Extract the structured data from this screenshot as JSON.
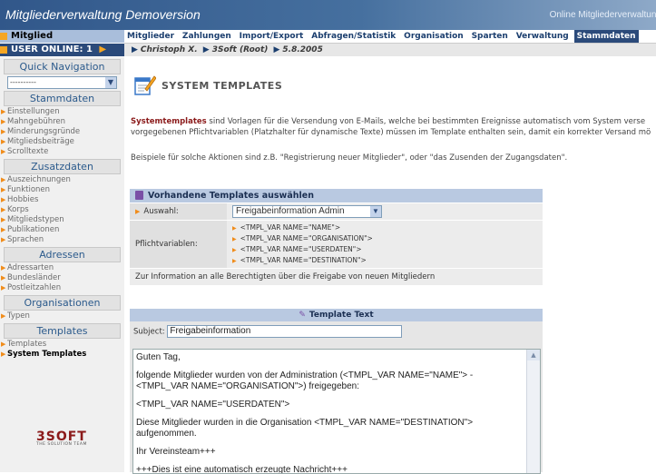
{
  "app": {
    "title": "Mitgliederverwaltung Demoversion",
    "top_right": "Online Mitgliederverwaltung"
  },
  "left": {
    "head_mitglied": "Mitglied",
    "user_online": "USER ONLINE: 1",
    "quick_nav": "Quick Navigation",
    "quick_select": "----------",
    "stammdaten_title": "Stammdaten",
    "stammdaten_items": [
      "Einstellungen",
      "Mahngebühren",
      "Minderungsgründe",
      "Mitgliedsbeiträge",
      "Scrolltexte"
    ],
    "zusatzdaten_title": "Zusatzdaten",
    "zusatzdaten_items": [
      "Auszeichnungen",
      "Funktionen",
      "Hobbies",
      "Korps",
      "Mitgliedstypen",
      "Publikationen",
      "Sprachen"
    ],
    "adressen_title": "Adressen",
    "adressen_items": [
      "Adressarten",
      "Bundesländer",
      "Postleitzahlen"
    ],
    "organisationen_title": "Organisationen",
    "organisationen_items": [
      "Typen"
    ],
    "templates_title": "Templates",
    "templates_items": [
      "Templates",
      "System Templates"
    ],
    "logo_text": "3SOFT",
    "logo_sub": "THE SOLUTION TEAM"
  },
  "menu": {
    "items": [
      "Mitglieder",
      "Zahlungen",
      "Import/Export",
      "Abfragen/Statistik",
      "Organisation",
      "Sparten",
      "Verwaltung",
      "Stammdaten"
    ],
    "active": "Stammdaten"
  },
  "breadcrumb": [
    "Christoph X.",
    "3Soft (Root)",
    "5.8.2005"
  ],
  "page": {
    "title": "SYSTEM TEMPLATES",
    "desc_bold": "Systemtemplates",
    "desc_line1_rest": " sind Vorlagen für die Versendung von E-Mails, welche bei bestimmten Ereignisse automatisch vom System verse",
    "desc_line2": "vorgegebenen Pflichtvariablen (Platzhalter für dynamische Texte) müssen im Template enthalten sein, damit ein korrekter Versand mö",
    "desc_example": "Beispiele für solche Aktionen sind z.B. \"Registrierung neuer Mitglieder\", oder \"das Zusenden der Zugangsdaten\"."
  },
  "templates_box": {
    "title": "Vorhandene Templates auswählen",
    "auswahl_label": "Auswahl:",
    "selected": "Freigabeinformation Admin",
    "pflicht_label": "Pflichtvariablen:",
    "variables": [
      "<TMPL_VAR NAME=\"NAME\">",
      "<TMPL_VAR NAME=\"ORGANISATION\">",
      "<TMPL_VAR NAME=\"USERDATEN\">",
      "<TMPL_VAR NAME=\"DESTINATION\">"
    ],
    "info": "Zur Information an alle Berechtigten über die Freigabe von neuen Mitgliedern"
  },
  "text_box": {
    "title": "Template Text",
    "subject_label": "Subject:",
    "subject_value": "Freigabeinformation",
    "body": [
      "Guten Tag,",
      "folgende Mitglieder wurden von der Administration (<TMPL_VAR NAME=\"NAME\"> - <TMPL_VAR NAME=\"ORGANISATION\">) freigegeben:",
      "<TMPL_VAR NAME=\"USERDATEN\">",
      "Diese Mitglieder wurden in die Organisation <TMPL_VAR NAME=\"DESTINATION\"> aufgenommen.",
      "Ihr Vereinsteam+++",
      "+++Dies ist eine automatisch erzeugte Nachricht+++"
    ]
  },
  "colors": {
    "header_blue": "#31578a",
    "accent_orange": "#f08c1a",
    "menu_active": "#2b4a7a",
    "brand_red": "#8b1a1a"
  }
}
